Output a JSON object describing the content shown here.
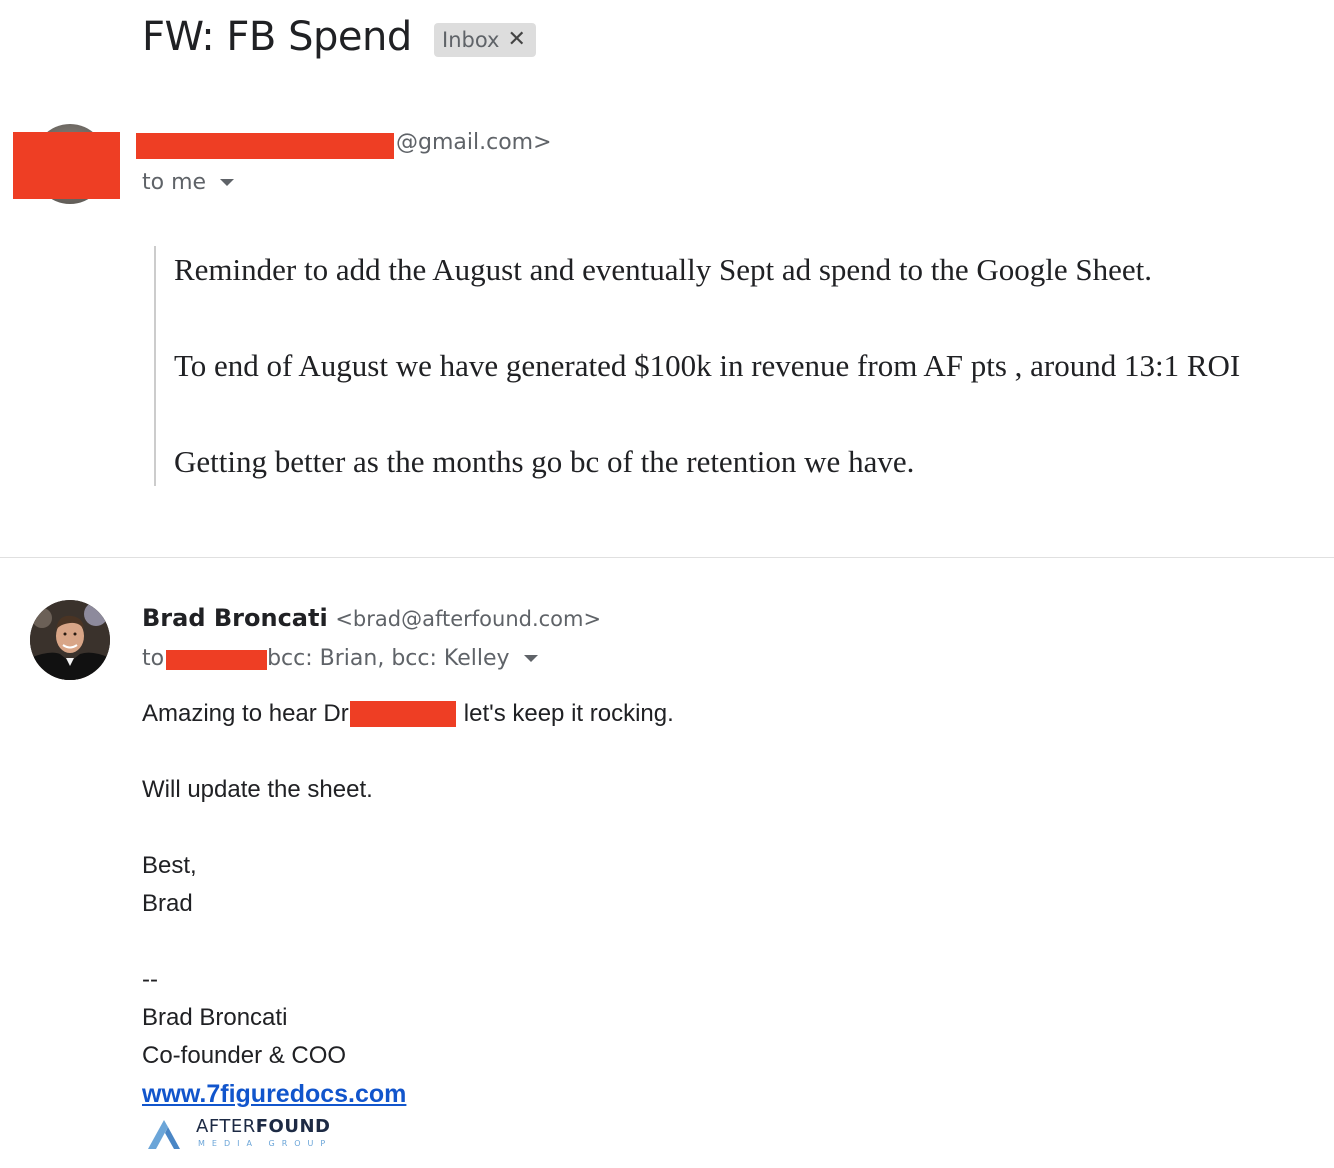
{
  "thread": {
    "subject": "FW: FB Spend",
    "label": "Inbox",
    "label_remove_icon": "close-icon"
  },
  "message1": {
    "sender_email_suffix": "@gmail.com>",
    "recipients_text": "to me",
    "quoted_body": [
      "Reminder to add the August and eventually Sept ad spend to the Google Sheet.",
      "To end of August we have generated $100k in revenue from AF pts , around 13:1 ROI",
      "Getting better as the months go bc of the retention we have."
    ]
  },
  "message2": {
    "sender_name": "Brad Broncati",
    "sender_email": "<brad@afterfound.com>",
    "recipients_prefix": "to",
    "recipients_rest": "bcc: Brian, bcc: Kelley",
    "body": {
      "line1_start": "Amazing to hear Dr",
      "line1_end": "let's keep it rocking.",
      "line2": "Will update the sheet.",
      "closing": "Best,",
      "name": "Brad"
    },
    "signature": {
      "separator": "--",
      "name": "Brad Broncati",
      "title": "Co-founder & COO",
      "link": "www.7figuredocs.com",
      "logo_text_light": "AFTER",
      "logo_text_bold": "FOUND",
      "logo_subtext": "MEDIA GROUP"
    }
  },
  "colors": {
    "redaction": "#ee3e24",
    "link": "#1155cc",
    "label_chip": "#dddddd"
  }
}
